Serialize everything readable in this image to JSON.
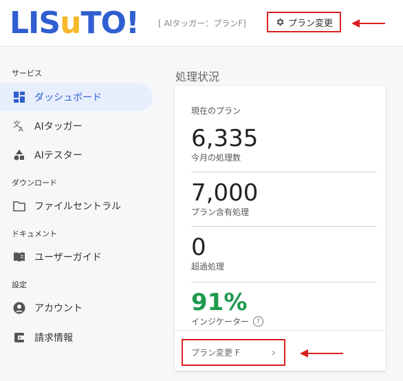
{
  "header": {
    "logo": {
      "part1": "LIS",
      "part2": "u",
      "part3": "TO!"
    },
    "plan_tag": "[ AIタッガー：プランF]",
    "plan_change_label": "プラン変更"
  },
  "sidebar": {
    "sections": [
      {
        "label": "サービス"
      },
      {
        "label": "ダウンロード"
      },
      {
        "label": "ドキュメント"
      },
      {
        "label": "設定"
      }
    ],
    "items": [
      {
        "label": "ダッシュボード"
      },
      {
        "label": "AIタッガー"
      },
      {
        "label": "AIテスター"
      },
      {
        "label": "ファイルセントラル"
      },
      {
        "label": "ユーザーガイド"
      },
      {
        "label": "アカウント"
      },
      {
        "label": "請求情報"
      }
    ]
  },
  "main": {
    "title": "処理状況",
    "current_plan_label": "現在のプラン",
    "stats": [
      {
        "value": "6,335",
        "caption": "今月の処理数"
      },
      {
        "value": "7,000",
        "caption": "プラン含有処理"
      },
      {
        "value": "0",
        "caption": "超過処理"
      },
      {
        "value": "91%",
        "caption": "インジケーター"
      }
    ],
    "footer_button": "プラン変更 F",
    "footer_chevron": "›",
    "help_icon": "?"
  },
  "colors": {
    "accent": "#2f5fd0",
    "logo_yellow": "#f6b92b",
    "highlight": "#d9201f",
    "indicator": "#1f9a4d"
  }
}
